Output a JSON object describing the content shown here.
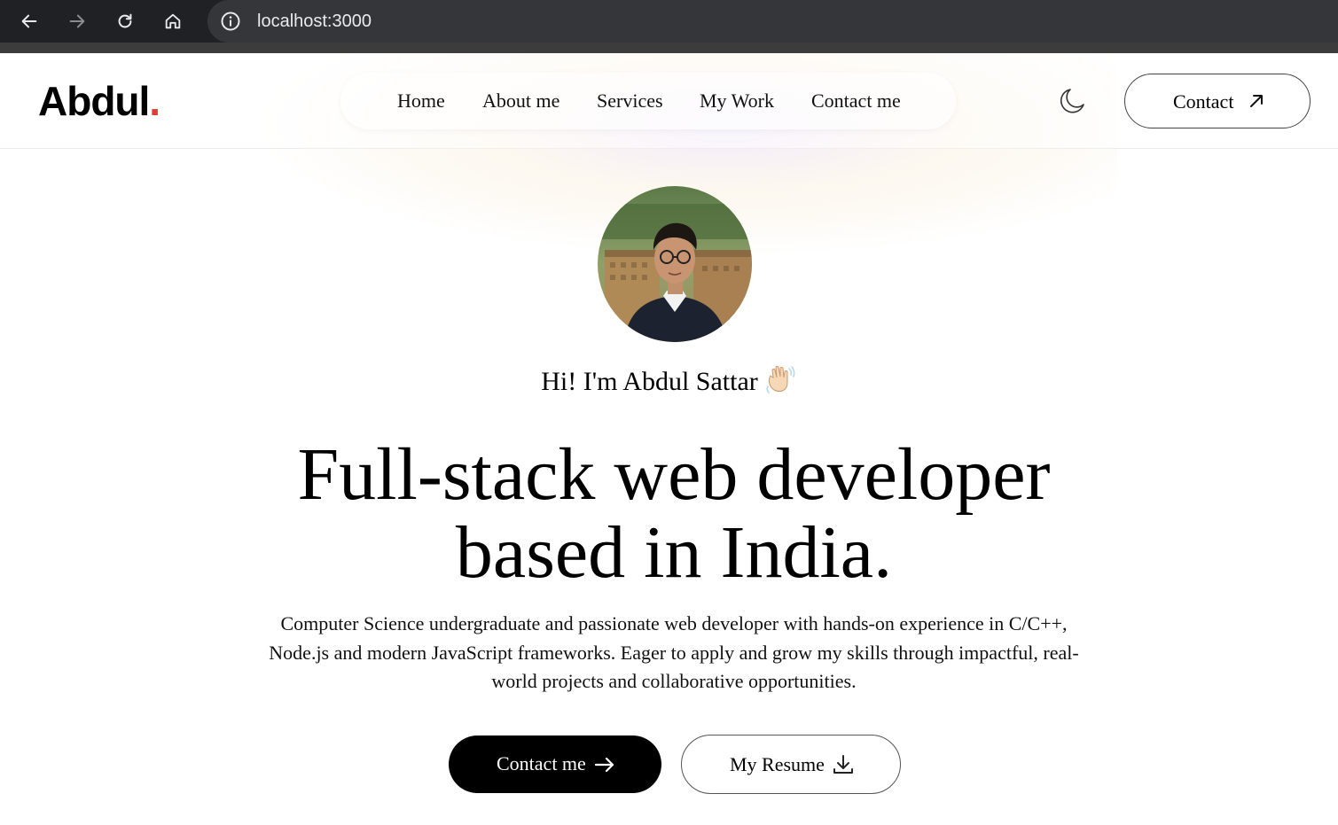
{
  "browser": {
    "url": "localhost:3000",
    "icons": [
      "back-icon",
      "forward-icon",
      "reload-icon",
      "home-icon",
      "site-info-icon"
    ]
  },
  "header": {
    "logo_text": "Abdul",
    "logo_dot": ".",
    "logo_dot_color": "#e53935",
    "nav": [
      "Home",
      "About me",
      "Services",
      "My Work",
      "Contact me"
    ],
    "theme_toggle_icon": "moon-icon",
    "contact_button": "Contact",
    "contact_button_icon": "arrow-up-right-icon"
  },
  "hero": {
    "avatar_icon": "profile-photo",
    "greeting": "Hi! I'm Abdul Sattar",
    "greeting_icon": "waving-hand-icon",
    "headline_line1": "Full-stack web developer",
    "headline_line2": "based in India.",
    "intro": "Computer Science undergraduate and passionate web developer with hands-on experience in C/C++, Node.js and modern JavaScript frameworks. Eager to apply and grow my skills through impactful, real-world projects and collaborative opportunities.",
    "primary_button": "Contact me",
    "primary_button_icon": "arrow-right-icon",
    "secondary_button": "My Resume",
    "secondary_button_icon": "download-icon"
  }
}
